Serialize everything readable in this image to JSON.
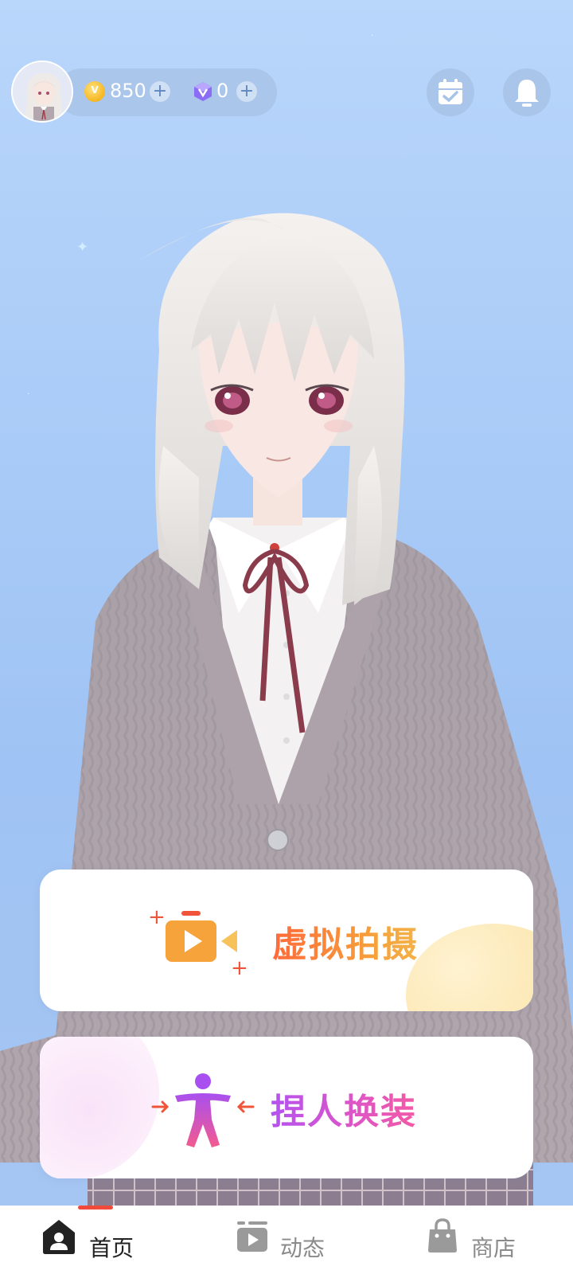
{
  "header": {
    "coins": "850",
    "gems": "0"
  },
  "actions": {
    "virtual_shoot_label": "虚拟拍摄",
    "customize_label": "捏人换装"
  },
  "nav": {
    "items": [
      {
        "label": "首页",
        "icon": "home-person-icon",
        "active": true
      },
      {
        "label": "动态",
        "icon": "video-feed-icon",
        "active": false
      },
      {
        "label": "商店",
        "icon": "shopping-bag-icon",
        "active": false
      }
    ],
    "active_color": "#f04a3a",
    "active_text_color": "#222222",
    "inactive_color": "#9a9a9a"
  }
}
